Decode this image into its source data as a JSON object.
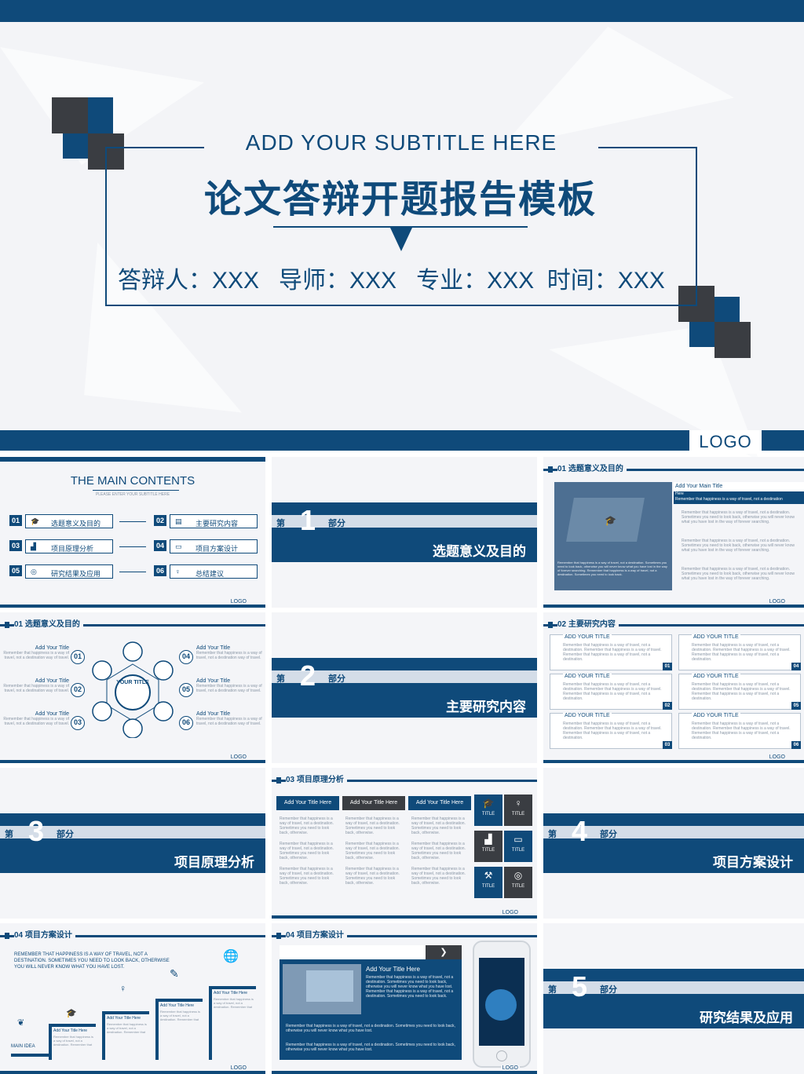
{
  "hero": {
    "subtitle": "ADD YOUR  SUBTITLE HERE",
    "title": "论文答辩开题报告模板",
    "info": "答辩人：XXX   导师：XXX   专业：XXX  时间：XXX",
    "logo": "LOGO"
  },
  "thumbs": {
    "contents": {
      "title": "THE MAIN CONTENTS",
      "sub": "PLEASE ENTER YOUR  SUBTITLE HERE",
      "items": [
        {
          "num": "01",
          "label": "选题意义及目的"
        },
        {
          "num": "02",
          "label": "主要研究内容"
        },
        {
          "num": "03",
          "label": "项目原理分析"
        },
        {
          "num": "04",
          "label": "项目方案设计"
        },
        {
          "num": "05",
          "label": "研究结果及应用"
        },
        {
          "num": "06",
          "label": "总结建议"
        }
      ],
      "logo": "LOGO"
    },
    "parts": [
      {
        "di": "第",
        "num": "1",
        "bu": "部分",
        "title": "选题意义及目的"
      },
      {
        "di": "第",
        "num": "2",
        "bu": "部分",
        "title": "主要研究内容"
      },
      {
        "di": "第",
        "num": "3",
        "bu": "部分",
        "title": "项目原理分析"
      },
      {
        "di": "第",
        "num": "4",
        "bu": "部分",
        "title": "项目方案设计"
      },
      {
        "di": "第",
        "num": "5",
        "bu": "部分",
        "title": "研究结果及应用"
      }
    ],
    "s01a": {
      "head": "01 选题意义及目的",
      "main_title": "Add Your Main Title",
      "here": "Here",
      "lead": "Remember that happiness is a way of travel, not a destination",
      "body": "Remember that happiness is a way of travel, not a destination. Sometimes you need to look back, otherwise you will never know what you have lost in the way of forever searching.",
      "img_text": "Remember that happiness is a way of travel, not a destination. Sometimes you need to look back, otherwise you will never know what you have lost in the way of forever searching. Remember that happiness is a way of travel, not a destination. Sometimes you need to look back.",
      "logo": "LOGO"
    },
    "s01b": {
      "head": "01 选题意义及目的",
      "center": "YOUR TITLE",
      "items": [
        {
          "num": "01",
          "title": "Add Your Title"
        },
        {
          "num": "02",
          "title": "Add Your Title"
        },
        {
          "num": "03",
          "title": "Add Your Title"
        },
        {
          "num": "04",
          "title": "Add Your Title"
        },
        {
          "num": "05",
          "title": "Add Your Title"
        },
        {
          "num": "06",
          "title": "Add Your Title"
        }
      ],
      "text": "Remember that happiness is a way of travel, not a destination way of travel.",
      "logo": "LOGO"
    },
    "s02": {
      "head": "02 主要研究内容",
      "cards": [
        {
          "title": "ADD YOUR TITLE",
          "num": "01"
        },
        {
          "title": "ADD YOUR TITLE",
          "num": "04"
        },
        {
          "title": "ADD YOUR TITLE",
          "num": "02"
        },
        {
          "title": "ADD YOUR TITLE",
          "num": "05"
        },
        {
          "title": "ADD YOUR TITLE",
          "num": "03"
        },
        {
          "title": "ADD YOUR TITLE",
          "num": "06"
        }
      ],
      "text": "Remember that happiness is a way of travel, not a destination. Remember that happiness is a way of travel. Remember that happiness is a way of travel, not a destination.",
      "logo": "LOGO"
    },
    "s03": {
      "head": "03 项目原理分析",
      "cols": [
        "Add Your Title Here",
        "Add Your Title Here",
        "Add Your Title Here"
      ],
      "text": "Remember that happiness is a way of travel, not a destination. Sometimes you need to look back, otherwise.",
      "tiles": [
        "TITLE",
        "TITLE",
        "TITLE",
        "TITLE",
        "TITLE",
        "TITLE"
      ],
      "logo": "LOGO"
    },
    "s04a": {
      "head": "04 项目方案设计",
      "lead": "REMEMBER THAT HAPPINESS IS A WAY OF TRAVEL, NOT A DESTINATION. SOMETIMES YOU NEED TO LOOK BACK, OTHERWISE YOU WILL NEVER KNOW WHAT YOU HAVE LOST.",
      "steps": [
        "Add Your Title Here",
        "Add Your Title Here",
        "Add Your Title Here",
        "Add Your Title Here"
      ],
      "step_text": "Remember that happiness is a way of travel, not a destination. Remember that",
      "main_idea": "MAIN IDEA",
      "logo": "LOGO"
    },
    "s04b": {
      "head": "04 项目方案设计",
      "title": "Add Your Title Here",
      "body": "Remember that happiness is a way of travel, not a destination. Sometimes you need to look back, otherwise you will never know what you have lost. Remember that happiness is a way of travel, not a destination. Sometimes you need to look back.",
      "bullet": "Remember that happiness is a way of travel, not a destination. Sometimes you need to look back, otherwise you will never know what you have lost.",
      "logo": "LOGO"
    }
  }
}
